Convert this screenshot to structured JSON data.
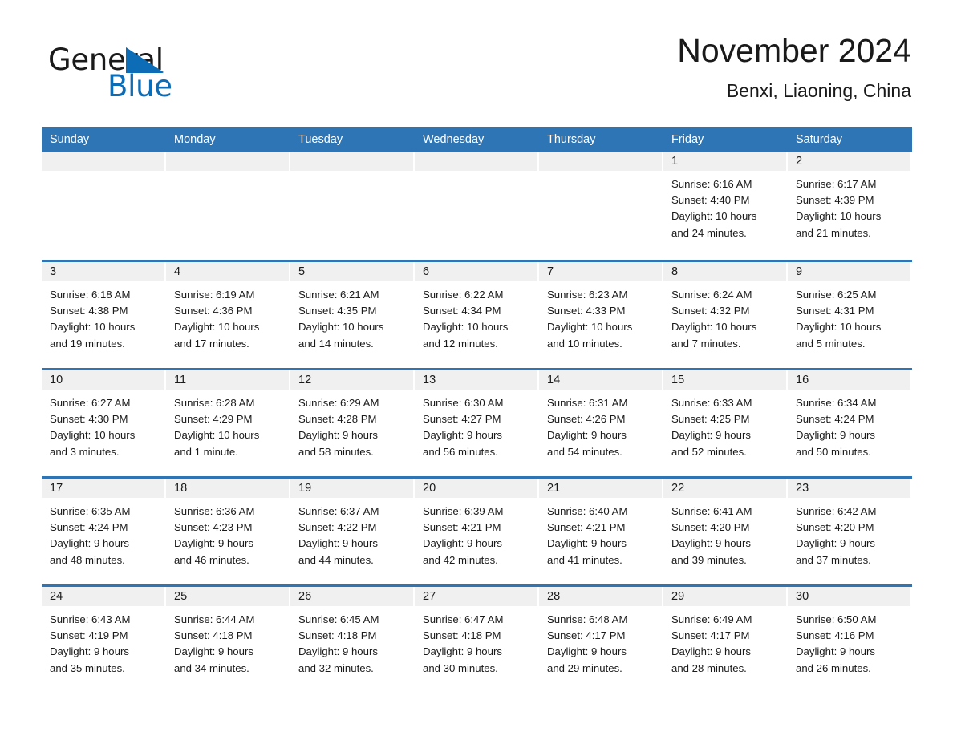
{
  "brand": {
    "name_part1": "General",
    "name_part2": "Blue",
    "triangle_icon": "triangle-icon",
    "accent_color": "#0d6cb6"
  },
  "header": {
    "title": "November 2024",
    "location": "Benxi, Liaoning, China"
  },
  "theme": {
    "header_blue": "#2e75b6",
    "band_gray": "#f0f0f0",
    "text": "#1a1a1a"
  },
  "calendar": {
    "weekday_headers": [
      "Sunday",
      "Monday",
      "Tuesday",
      "Wednesday",
      "Thursday",
      "Friday",
      "Saturday"
    ],
    "weeks": [
      [
        {
          "day": "",
          "empty": true
        },
        {
          "day": "",
          "empty": true
        },
        {
          "day": "",
          "empty": true
        },
        {
          "day": "",
          "empty": true
        },
        {
          "day": "",
          "empty": true
        },
        {
          "day": "1",
          "sunrise": "Sunrise: 6:16 AM",
          "sunset": "Sunset: 4:40 PM",
          "daylight_line1": "Daylight: 10 hours",
          "daylight_line2": "and 24 minutes."
        },
        {
          "day": "2",
          "sunrise": "Sunrise: 6:17 AM",
          "sunset": "Sunset: 4:39 PM",
          "daylight_line1": "Daylight: 10 hours",
          "daylight_line2": "and 21 minutes."
        }
      ],
      [
        {
          "day": "3",
          "sunrise": "Sunrise: 6:18 AM",
          "sunset": "Sunset: 4:38 PM",
          "daylight_line1": "Daylight: 10 hours",
          "daylight_line2": "and 19 minutes."
        },
        {
          "day": "4",
          "sunrise": "Sunrise: 6:19 AM",
          "sunset": "Sunset: 4:36 PM",
          "daylight_line1": "Daylight: 10 hours",
          "daylight_line2": "and 17 minutes."
        },
        {
          "day": "5",
          "sunrise": "Sunrise: 6:21 AM",
          "sunset": "Sunset: 4:35 PM",
          "daylight_line1": "Daylight: 10 hours",
          "daylight_line2": "and 14 minutes."
        },
        {
          "day": "6",
          "sunrise": "Sunrise: 6:22 AM",
          "sunset": "Sunset: 4:34 PM",
          "daylight_line1": "Daylight: 10 hours",
          "daylight_line2": "and 12 minutes."
        },
        {
          "day": "7",
          "sunrise": "Sunrise: 6:23 AM",
          "sunset": "Sunset: 4:33 PM",
          "daylight_line1": "Daylight: 10 hours",
          "daylight_line2": "and 10 minutes."
        },
        {
          "day": "8",
          "sunrise": "Sunrise: 6:24 AM",
          "sunset": "Sunset: 4:32 PM",
          "daylight_line1": "Daylight: 10 hours",
          "daylight_line2": "and 7 minutes."
        },
        {
          "day": "9",
          "sunrise": "Sunrise: 6:25 AM",
          "sunset": "Sunset: 4:31 PM",
          "daylight_line1": "Daylight: 10 hours",
          "daylight_line2": "and 5 minutes."
        }
      ],
      [
        {
          "day": "10",
          "sunrise": "Sunrise: 6:27 AM",
          "sunset": "Sunset: 4:30 PM",
          "daylight_line1": "Daylight: 10 hours",
          "daylight_line2": "and 3 minutes."
        },
        {
          "day": "11",
          "sunrise": "Sunrise: 6:28 AM",
          "sunset": "Sunset: 4:29 PM",
          "daylight_line1": "Daylight: 10 hours",
          "daylight_line2": "and 1 minute."
        },
        {
          "day": "12",
          "sunrise": "Sunrise: 6:29 AM",
          "sunset": "Sunset: 4:28 PM",
          "daylight_line1": "Daylight: 9 hours",
          "daylight_line2": "and 58 minutes."
        },
        {
          "day": "13",
          "sunrise": "Sunrise: 6:30 AM",
          "sunset": "Sunset: 4:27 PM",
          "daylight_line1": "Daylight: 9 hours",
          "daylight_line2": "and 56 minutes."
        },
        {
          "day": "14",
          "sunrise": "Sunrise: 6:31 AM",
          "sunset": "Sunset: 4:26 PM",
          "daylight_line1": "Daylight: 9 hours",
          "daylight_line2": "and 54 minutes."
        },
        {
          "day": "15",
          "sunrise": "Sunrise: 6:33 AM",
          "sunset": "Sunset: 4:25 PM",
          "daylight_line1": "Daylight: 9 hours",
          "daylight_line2": "and 52 minutes."
        },
        {
          "day": "16",
          "sunrise": "Sunrise: 6:34 AM",
          "sunset": "Sunset: 4:24 PM",
          "daylight_line1": "Daylight: 9 hours",
          "daylight_line2": "and 50 minutes."
        }
      ],
      [
        {
          "day": "17",
          "sunrise": "Sunrise: 6:35 AM",
          "sunset": "Sunset: 4:24 PM",
          "daylight_line1": "Daylight: 9 hours",
          "daylight_line2": "and 48 minutes."
        },
        {
          "day": "18",
          "sunrise": "Sunrise: 6:36 AM",
          "sunset": "Sunset: 4:23 PM",
          "daylight_line1": "Daylight: 9 hours",
          "daylight_line2": "and 46 minutes."
        },
        {
          "day": "19",
          "sunrise": "Sunrise: 6:37 AM",
          "sunset": "Sunset: 4:22 PM",
          "daylight_line1": "Daylight: 9 hours",
          "daylight_line2": "and 44 minutes."
        },
        {
          "day": "20",
          "sunrise": "Sunrise: 6:39 AM",
          "sunset": "Sunset: 4:21 PM",
          "daylight_line1": "Daylight: 9 hours",
          "daylight_line2": "and 42 minutes."
        },
        {
          "day": "21",
          "sunrise": "Sunrise: 6:40 AM",
          "sunset": "Sunset: 4:21 PM",
          "daylight_line1": "Daylight: 9 hours",
          "daylight_line2": "and 41 minutes."
        },
        {
          "day": "22",
          "sunrise": "Sunrise: 6:41 AM",
          "sunset": "Sunset: 4:20 PM",
          "daylight_line1": "Daylight: 9 hours",
          "daylight_line2": "and 39 minutes."
        },
        {
          "day": "23",
          "sunrise": "Sunrise: 6:42 AM",
          "sunset": "Sunset: 4:20 PM",
          "daylight_line1": "Daylight: 9 hours",
          "daylight_line2": "and 37 minutes."
        }
      ],
      [
        {
          "day": "24",
          "sunrise": "Sunrise: 6:43 AM",
          "sunset": "Sunset: 4:19 PM",
          "daylight_line1": "Daylight: 9 hours",
          "daylight_line2": "and 35 minutes."
        },
        {
          "day": "25",
          "sunrise": "Sunrise: 6:44 AM",
          "sunset": "Sunset: 4:18 PM",
          "daylight_line1": "Daylight: 9 hours",
          "daylight_line2": "and 34 minutes."
        },
        {
          "day": "26",
          "sunrise": "Sunrise: 6:45 AM",
          "sunset": "Sunset: 4:18 PM",
          "daylight_line1": "Daylight: 9 hours",
          "daylight_line2": "and 32 minutes."
        },
        {
          "day": "27",
          "sunrise": "Sunrise: 6:47 AM",
          "sunset": "Sunset: 4:18 PM",
          "daylight_line1": "Daylight: 9 hours",
          "daylight_line2": "and 30 minutes."
        },
        {
          "day": "28",
          "sunrise": "Sunrise: 6:48 AM",
          "sunset": "Sunset: 4:17 PM",
          "daylight_line1": "Daylight: 9 hours",
          "daylight_line2": "and 29 minutes."
        },
        {
          "day": "29",
          "sunrise": "Sunrise: 6:49 AM",
          "sunset": "Sunset: 4:17 PM",
          "daylight_line1": "Daylight: 9 hours",
          "daylight_line2": "and 28 minutes."
        },
        {
          "day": "30",
          "sunrise": "Sunrise: 6:50 AM",
          "sunset": "Sunset: 4:16 PM",
          "daylight_line1": "Daylight: 9 hours",
          "daylight_line2": "and 26 minutes."
        }
      ]
    ]
  }
}
